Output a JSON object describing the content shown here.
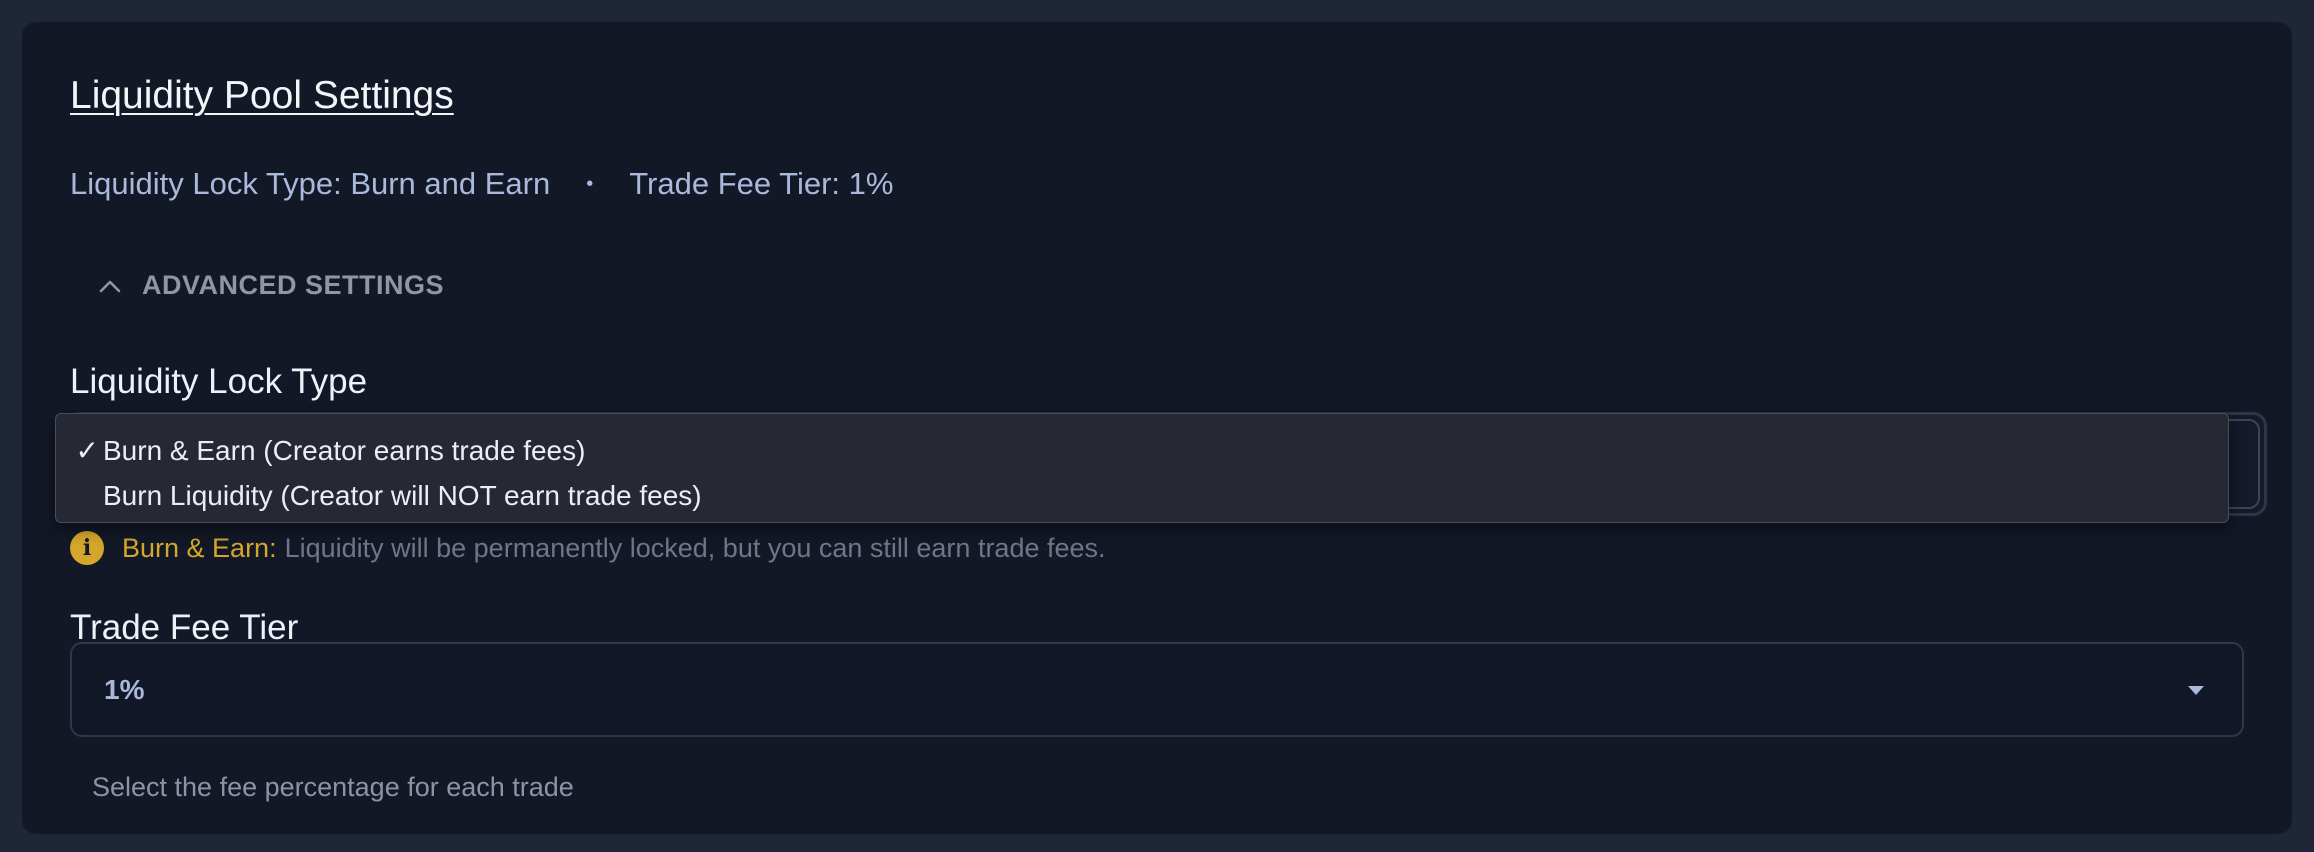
{
  "section": {
    "title": "Liquidity Pool Settings"
  },
  "summary": {
    "lock_type": "Liquidity Lock Type: Burn and Earn",
    "separator": "•",
    "fee_tier": "Trade Fee Tier: 1%"
  },
  "advanced": {
    "label": "ADVANCED SETTINGS",
    "icon": "chevron-up-icon"
  },
  "lock_type": {
    "label": "Liquidity Lock Type",
    "options": [
      {
        "check": "✓",
        "label": "Burn & Earn (Creator earns trade fees)",
        "selected": true
      },
      {
        "check": "",
        "label": "Burn Liquidity (Creator will NOT earn trade fees)",
        "selected": false
      }
    ],
    "info_key": "Burn & Earn:",
    "info_text": "Liquidity will be permanently locked, but you can still earn trade fees.",
    "info_icon": "info-icon"
  },
  "fee_tier": {
    "label": "Trade Fee Tier",
    "value": "1%",
    "helper": "Select the fee percentage for each trade",
    "icon": "caret-down-icon"
  },
  "colors": {
    "page_bg": "#1f2637",
    "panel_bg": "#121826",
    "accent_text": "#a9b8db",
    "warning": "#d4a72c",
    "dropdown_bg": "#262833"
  }
}
